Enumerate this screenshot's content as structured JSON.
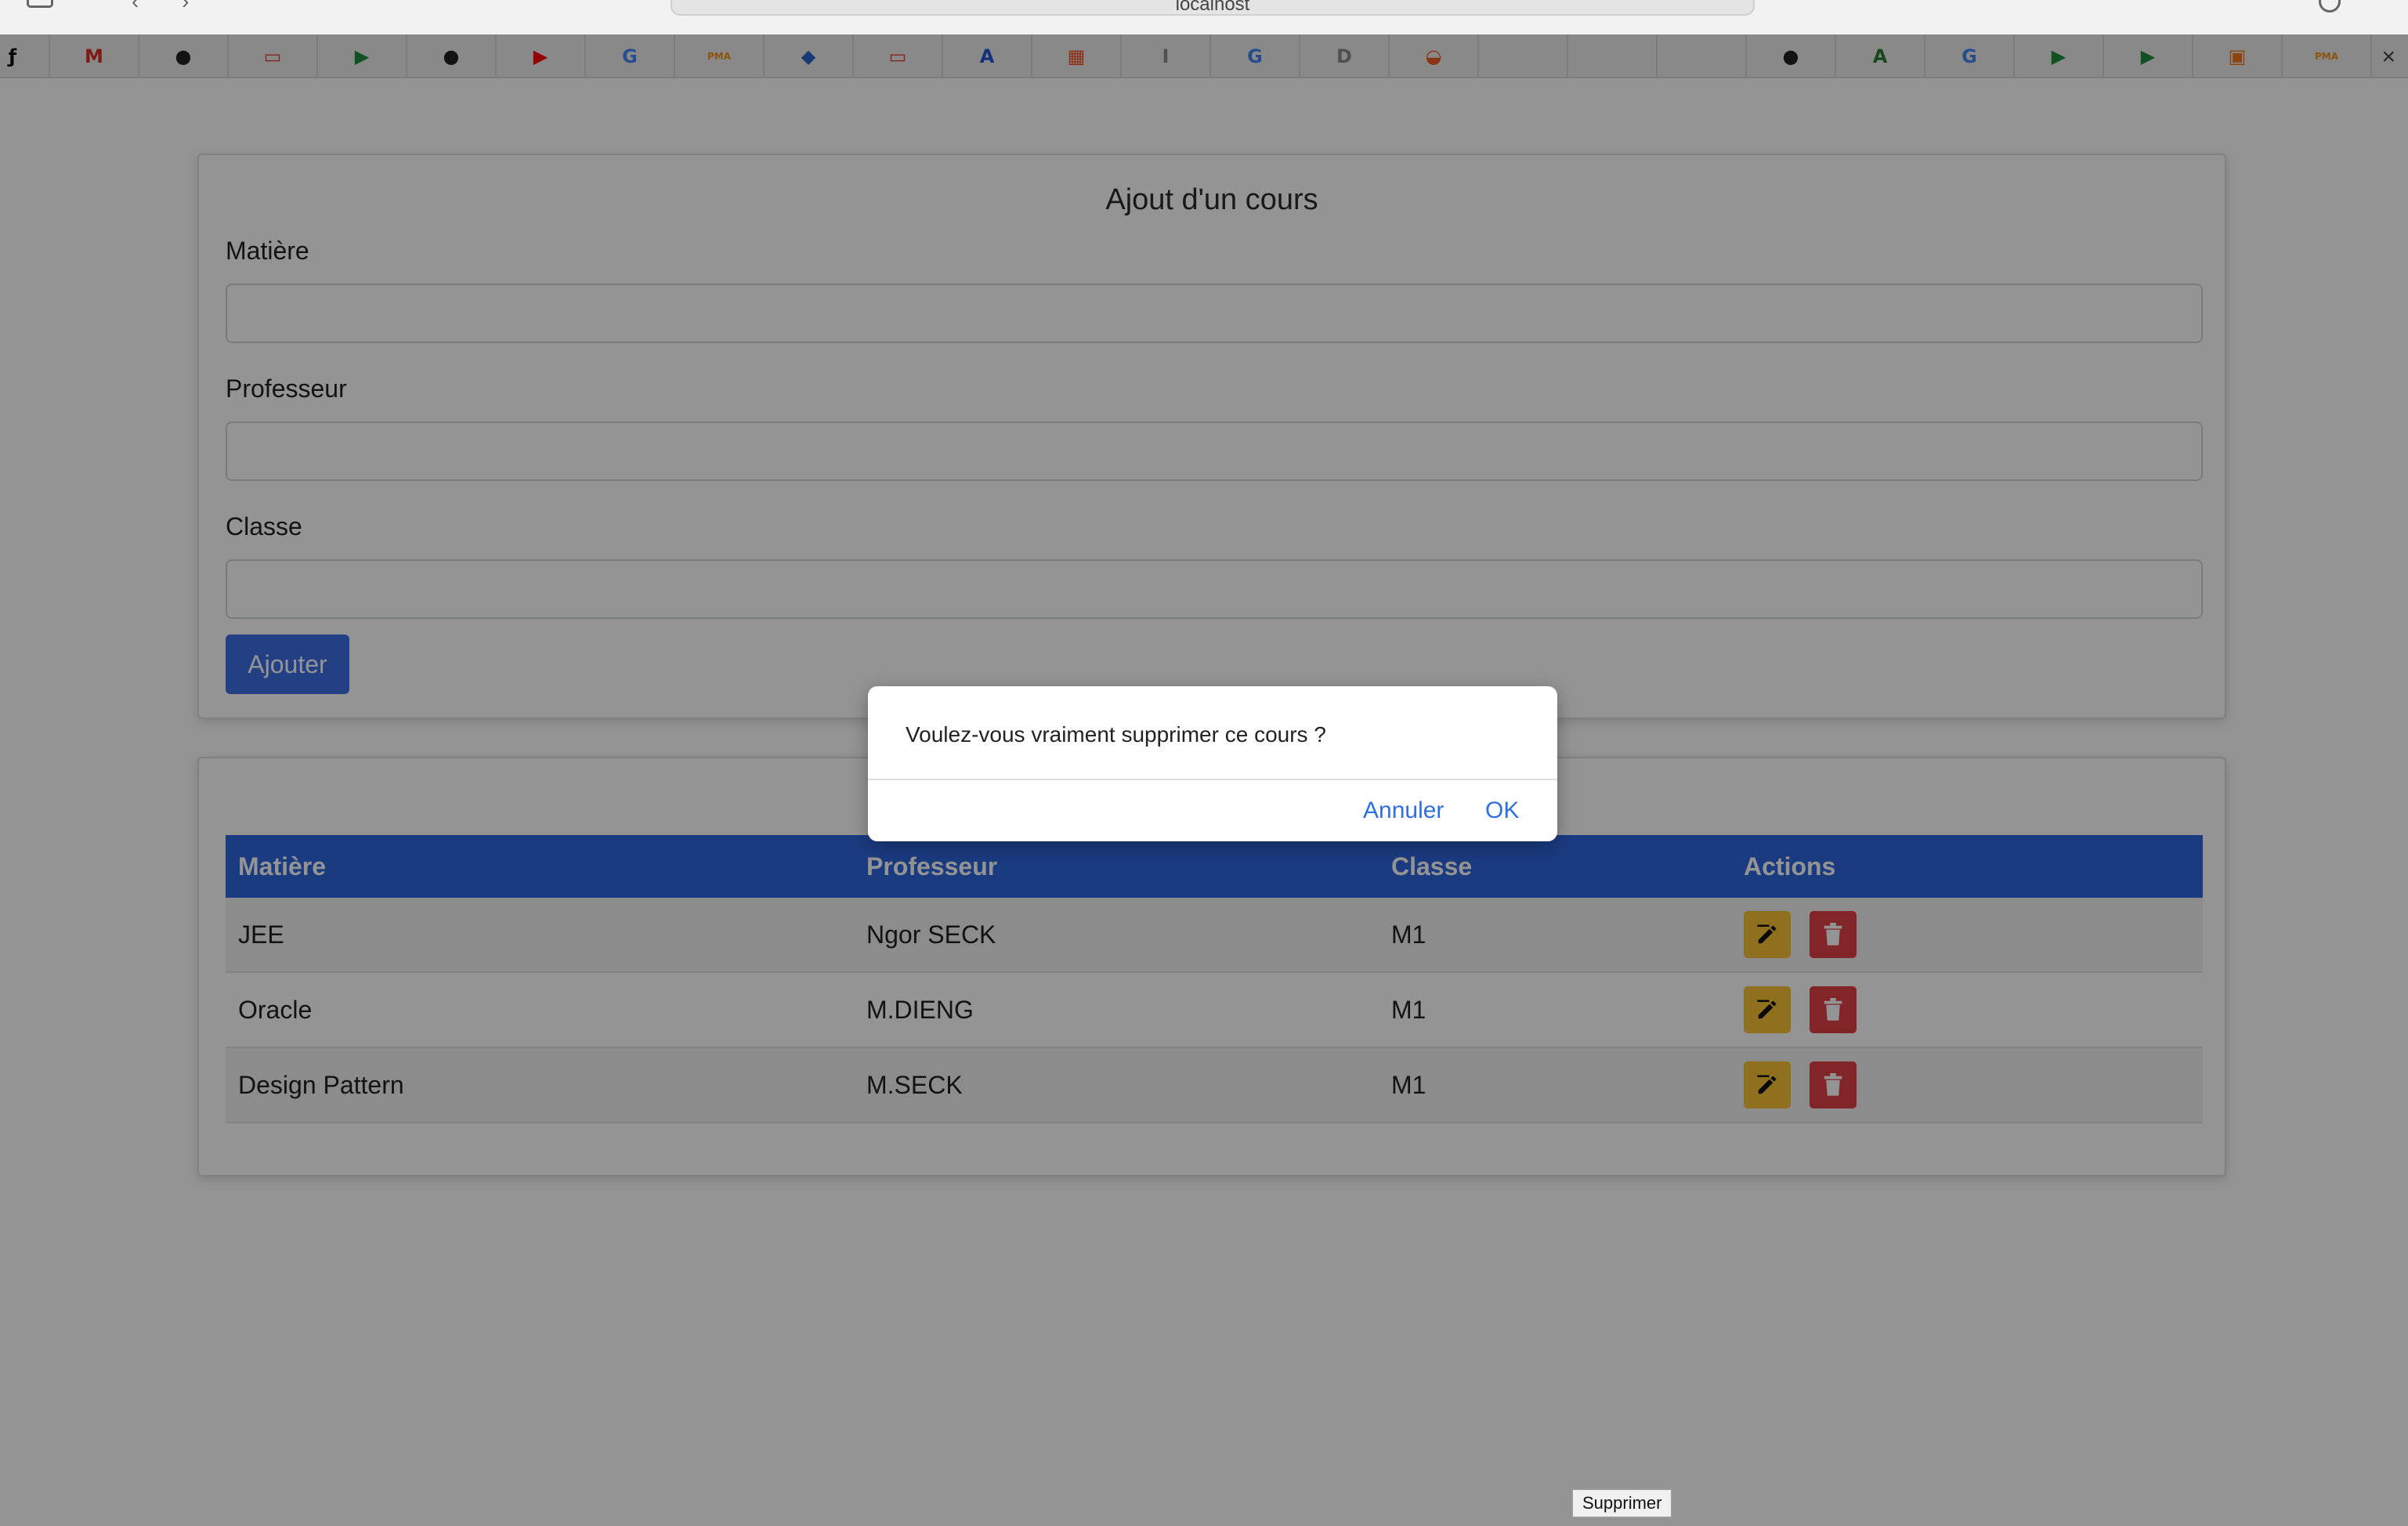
{
  "browser": {
    "url_text": "localhost",
    "favorites": [
      {
        "name": "symfony",
        "glyph": "ƒ",
        "color": "#111111"
      },
      {
        "name": "gmail",
        "glyph": "M",
        "color": "#d93025"
      },
      {
        "name": "github",
        "glyph": "●",
        "color": "#222222"
      },
      {
        "name": "oracle",
        "glyph": "▭",
        "color": "#e0362d"
      },
      {
        "name": "google-meet",
        "glyph": "▶",
        "color": "#1e8e3e"
      },
      {
        "name": "github",
        "glyph": "●",
        "color": "#222222"
      },
      {
        "name": "youtube",
        "glyph": "▶",
        "color": "#ff0000"
      },
      {
        "name": "google",
        "glyph": "G",
        "color": "#4285f4"
      },
      {
        "name": "phpmyadmin",
        "glyph": "PMA",
        "color": "#f29111"
      },
      {
        "name": "3d-box",
        "glyph": "◆",
        "color": "#2a62c9"
      },
      {
        "name": "oracle-red",
        "glyph": "▭",
        "color": "#e0362d"
      },
      {
        "name": "circle-a",
        "glyph": "A",
        "color": "#2356d1"
      },
      {
        "name": "microsoft",
        "glyph": "▦",
        "color": "#f25022"
      },
      {
        "name": "i-letter",
        "glyph": "I",
        "color": "#8a8a8a"
      },
      {
        "name": "google",
        "glyph": "G",
        "color": "#4285f4"
      },
      {
        "name": "d-letter",
        "glyph": "D",
        "color": "#8a8a8a"
      },
      {
        "name": "orange-bag",
        "glyph": "◒",
        "color": "#f25a1e"
      },
      {
        "name": "apple",
        "glyph": "",
        "color": "#777777"
      },
      {
        "name": "apple",
        "glyph": "",
        "color": "#777777"
      },
      {
        "name": "apple",
        "glyph": "",
        "color": "#777777"
      },
      {
        "name": "github",
        "glyph": "●",
        "color": "#222222"
      },
      {
        "name": "green-a",
        "glyph": "A",
        "color": "#2e7d32"
      },
      {
        "name": "google",
        "glyph": "G",
        "color": "#4285f4"
      },
      {
        "name": "google-meet",
        "glyph": "▶",
        "color": "#1e8e3e"
      },
      {
        "name": "google-meet",
        "glyph": "▶",
        "color": "#1e8e3e"
      },
      {
        "name": "orange-square",
        "glyph": "▣",
        "color": "#f5741e"
      },
      {
        "name": "phpmyadmin",
        "glyph": "PMA",
        "color": "#f29111"
      }
    ],
    "close_label": "×"
  },
  "form": {
    "title": "Ajout d'un cours",
    "matiere_label": "Matière",
    "matiere_value": "",
    "professeur_label": "Professeur",
    "professeur_value": "",
    "classe_label": "Classe",
    "classe_value": "",
    "submit_label": "Ajouter"
  },
  "table": {
    "headers": [
      "Matière",
      "Professeur",
      "Classe",
      "Actions"
    ],
    "rows": [
      {
        "matiere": "JEE",
        "professeur": "Ngor SECK",
        "classe": "M1"
      },
      {
        "matiere": "Oracle",
        "professeur": "M.DIENG",
        "classe": "M1"
      },
      {
        "matiere": "Design Pattern",
        "professeur": "M.SECK",
        "classe": "M1"
      }
    ]
  },
  "dialog": {
    "message": "Voulez-vous vraiment supprimer ce cours ?",
    "cancel_label": "Annuler",
    "ok_label": "OK"
  },
  "tooltip": {
    "text": "Supprimer"
  },
  "colors": {
    "primary": "#3d6fe6",
    "table_header": "#2f67de",
    "edit_button": "#f7c136",
    "delete_button": "#de4148",
    "link": "#2f6fde"
  }
}
